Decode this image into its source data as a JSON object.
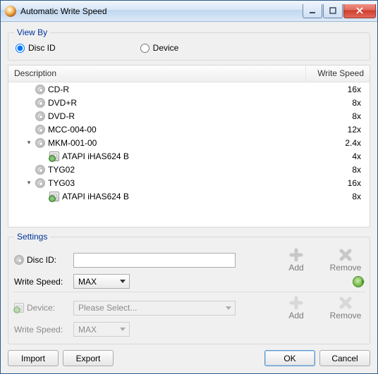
{
  "window": {
    "title": "Automatic Write Speed"
  },
  "viewby": {
    "legend": "View By",
    "disc_label": "Disc ID",
    "device_label": "Device",
    "selected": "disc"
  },
  "columns": {
    "description": "Description",
    "write_speed": "Write Speed"
  },
  "rows": [
    {
      "type": "disc",
      "level": 0,
      "expander": "",
      "label": "CD-R",
      "speed": "16x"
    },
    {
      "type": "disc",
      "level": 0,
      "expander": "",
      "label": "DVD+R",
      "speed": "8x"
    },
    {
      "type": "disc",
      "level": 0,
      "expander": "",
      "label": "DVD-R",
      "speed": "8x"
    },
    {
      "type": "disc",
      "level": 0,
      "expander": "",
      "label": "MCC-004-00",
      "speed": "12x"
    },
    {
      "type": "disc",
      "level": 0,
      "expander": "▾",
      "label": "MKM-001-00",
      "speed": "2.4x"
    },
    {
      "type": "device",
      "level": 1,
      "expander": "",
      "label": "ATAPI iHAS624   B",
      "speed": "4x"
    },
    {
      "type": "disc",
      "level": 0,
      "expander": "",
      "label": "TYG02",
      "speed": "8x"
    },
    {
      "type": "disc",
      "level": 0,
      "expander": "▾",
      "label": "TYG03",
      "speed": "16x"
    },
    {
      "type": "device",
      "level": 1,
      "expander": "",
      "label": "ATAPI iHAS624   B",
      "speed": "8x"
    }
  ],
  "settings": {
    "legend": "Settings",
    "disc_id_label": "Disc ID:",
    "disc_id_value": "",
    "write_speed_label": "Write Speed:",
    "write_speed_value": "MAX",
    "device_label": "Device:",
    "device_value": "Please Select...",
    "device_write_speed_label": "Write Speed:",
    "device_write_speed_value": "MAX",
    "add_label": "Add",
    "remove_label": "Remove"
  },
  "buttons": {
    "import": "Import",
    "export": "Export",
    "ok": "OK",
    "cancel": "Cancel"
  }
}
